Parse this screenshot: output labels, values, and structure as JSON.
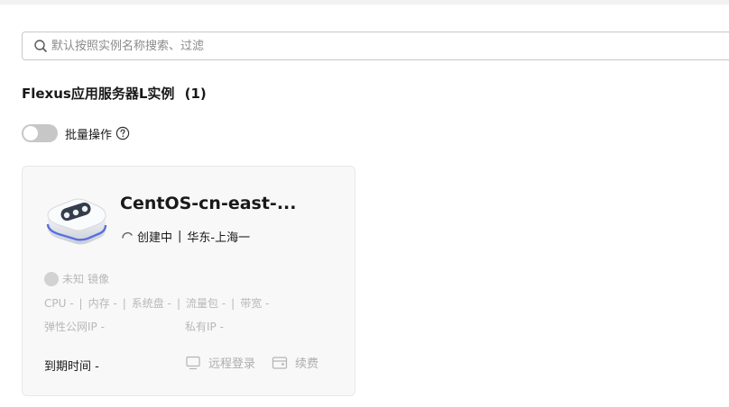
{
  "search": {
    "placeholder": "默认按照实例名称搜索、过滤",
    "icon": "search-icon"
  },
  "section": {
    "title": "Flexus应用服务器L实例",
    "count": "(1)"
  },
  "batch": {
    "label": "批量操作",
    "toggle_on": false
  },
  "instance": {
    "name": "CentOS-cn-east-...",
    "status": "创建中",
    "region": "华东-上海一",
    "image_status": "未知",
    "image_label": "镜像",
    "specs": [
      "CPU -",
      "内存 -",
      "系统盘 -",
      "流量包 -",
      "带宽 -"
    ],
    "public_ip": "弹性公网IP -",
    "private_ip": "私有IP -",
    "expire": "到期时间 -",
    "actions": {
      "remote_login": "远程登录",
      "renew": "续费"
    }
  },
  "colors": {
    "accent": "#5a6ee0",
    "muted_text": "#b8b8b8",
    "action_text": "#adadad"
  }
}
